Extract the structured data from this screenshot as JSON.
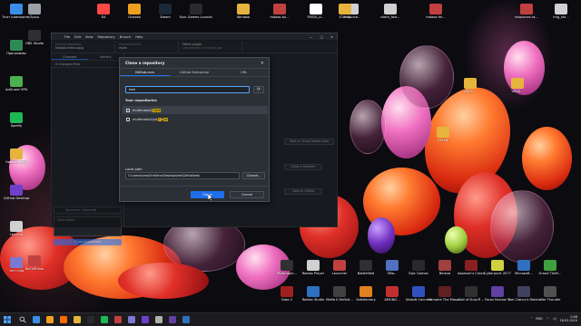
{
  "desktop": {
    "icons_left": [
      {
        "label": "Этот компьютер",
        "color": "#3a8ee6"
      },
      {
        "label": "Программы",
        "color": "#2e8b57"
      },
      {
        "label": "AdGuard VPN",
        "color": "#4caf50"
      },
      {
        "label": "Spotify",
        "color": "#1db954"
      },
      {
        "label": "Новая папка",
        "color": "#e6b43c"
      },
      {
        "label": "GitHub Desktop",
        "color": "#6e40c9"
      },
      {
        "label": "тест.txt",
        "color": "#d0d0d0"
      },
      {
        "label": "тест.cpp",
        "color": "#7a7ad0"
      }
    ],
    "icons_col2": [
      {
        "label": "Трэш",
        "color": "#9aa0a6"
      },
      {
        "label": "OBS Studio",
        "color": "#302e31"
      },
      {
        "label": "ReCUM.exe",
        "color": "#c04040"
      }
    ],
    "icons_top": [
      {
        "label": "EA",
        "color": "#ff4747"
      },
      {
        "label": "Основа",
        "color": "#f0a020"
      },
      {
        "label": "Steam",
        "color": "#1b2838"
      },
      {
        "label": "Epic Games Launcher",
        "color": "#2a2a2a"
      },
      {
        "label": "Window",
        "color": "#e6b43c"
      },
      {
        "label": "mbase-bu...",
        "color": "#c04040"
      },
      {
        "label": "FMOD_LI...",
        "color": "#ffffff"
      },
      {
        "label": "resource...",
        "color": "#d0d0d0"
      },
      {
        "label": "GTA SA",
        "color": "#e6b43c"
      },
      {
        "label": "client_fast...",
        "color": "#d0d0d0"
      },
      {
        "label": "mbase-fm...",
        "color": "#c04040"
      },
      {
        "label": "resources.ra...",
        "color": "#c04040"
      },
      {
        "label": "img_sfx...",
        "color": "#d0d0d0"
      }
    ],
    "icons_right": [
      {
        "label": "VKDS...",
        "color": "#e6b43c"
      },
      {
        "label": "VKDS...",
        "color": "#e6b43c"
      },
      {
        "label": "GitHub",
        "color": "#e6b43c"
      }
    ],
    "icons_bottom_row1": [
      {
        "label": "Phasmoph...",
        "color": "#303030"
      },
      {
        "label": "Roblox Player",
        "color": "#d0d0d0"
      },
      {
        "label": "Launcher",
        "color": "#c04040"
      },
      {
        "label": "Battlefield",
        "color": "#303030"
      },
      {
        "label": "Оби...",
        "color": "#5070c0"
      },
      {
        "label": "Epic Games",
        "color": "#2a2a2a"
      },
      {
        "label": "Bereza",
        "color": "#a04040"
      },
      {
        "label": "Assassin's Creed",
        "color": "#8a2020"
      },
      {
        "label": "Cyberpunk 2077",
        "color": "#d0d040"
      },
      {
        "label": "Microsoft...",
        "color": "#3070c0"
      },
      {
        "label": "Grand Theft...",
        "color": "#40a040"
      }
    ],
    "icons_bottom_row2": [
      {
        "label": "Dota 2",
        "color": "#a02020"
      },
      {
        "label": "Roblox Studio",
        "color": "#3070c0"
      },
      {
        "label": "Mafia II Definit...",
        "color": "#404040"
      },
      {
        "label": "Satisfactory",
        "color": "#e08020"
      },
      {
        "label": "AMONG...",
        "color": "#c03030"
      },
      {
        "label": "Ubisoft Connect",
        "color": "#3050c0"
      },
      {
        "label": "Vampire The Masquera...",
        "color": "#602020"
      },
      {
        "label": "Call of Duty®...",
        "color": "#303030"
      },
      {
        "label": "Forza Horizon 4",
        "color": "#6040a0"
      },
      {
        "label": "Tom Clancy's Rainbow Si...",
        "color": "#404060"
      },
      {
        "label": "War Thunder",
        "color": "#505050"
      }
    ]
  },
  "ghd": {
    "menu": [
      "File",
      "Edit",
      "View",
      "Repository",
      "Branch",
      "Help"
    ],
    "current_repo_caption": "Current repository",
    "current_repo": "Install-mirror-app",
    "current_branch_caption": "Current branch",
    "current_branch": "main",
    "fetch_caption": "Fetch origin",
    "fetch_sub": "Last fetched 2 minutes ago",
    "tab_changes": "Changes",
    "tab_history": "History",
    "changed_files": "0 changed files",
    "summary_placeholder": "Summary (required)",
    "description_placeholder": "Description",
    "commit_button": "Commit to main",
    "main_btn1": "Open in Visual Studio Code",
    "main_btn2": "Show in Explorer",
    "main_btn3": "View on GitHub"
  },
  "dialog": {
    "title": "Clone a repository",
    "close": "×",
    "tabs": [
      "GitHub.com",
      "GitHub Enterprise",
      "URL"
    ],
    "filter_value": "test",
    "refresh_icon": "⟳",
    "section": "Your repositories",
    "repos": [
      {
        "prefix": "multimaks2/",
        "match": "test",
        "suffix": ""
      },
      {
        "prefix": "multimaks2/git-",
        "match": "t",
        "mid": "e",
        "match2": "st",
        "suffix": ""
      }
    ],
    "local_path_label": "Local path",
    "local_path_value": "C:\\Users\\isma\\OneDrive\\Desktop\\test\\GitHub\\test",
    "choose_button": "Choose...",
    "clone_button": "Clone",
    "cancel_button": "Cancel"
  },
  "taskbar": {
    "apps": [
      "#3a8ee6",
      "#f0a020",
      "#ff6a00",
      "#e6b43c",
      "#2a2a2a",
      "#1db954",
      "#c04040",
      "#7a7ad0",
      "#6e40c9",
      "#b0b0b0",
      "#6040a0",
      "#3070c0"
    ],
    "lang": "ENG",
    "time": "0:48",
    "date": "18.05.2024"
  }
}
